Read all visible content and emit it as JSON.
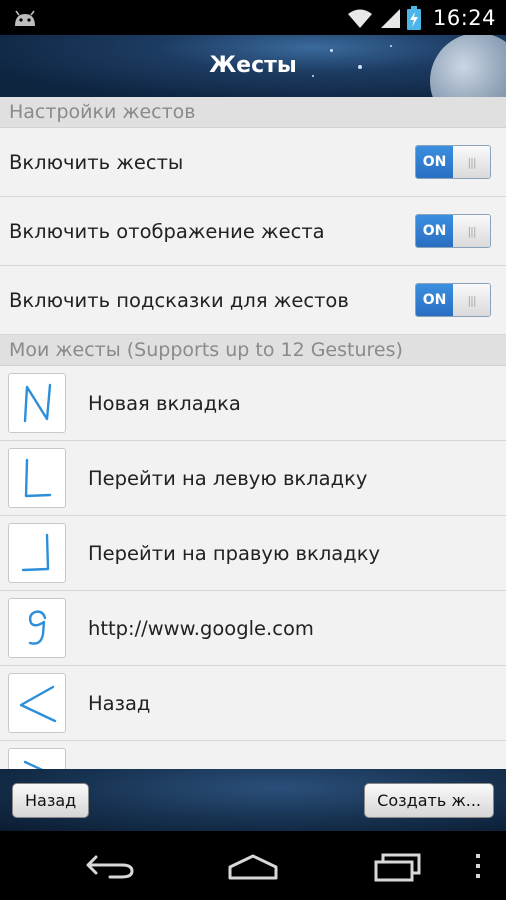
{
  "status_bar": {
    "time": "16:24",
    "icons": [
      "android-icon",
      "wifi-icon",
      "signal-icon",
      "battery-charging-icon"
    ]
  },
  "app_bar": {
    "title": "Жесты"
  },
  "settings_section": {
    "header": "Настройки жестов",
    "items": [
      {
        "label": "Включить жесты",
        "toggle": "ON"
      },
      {
        "label": "Включить отображение жеста",
        "toggle": "ON"
      },
      {
        "label": "Включить подсказки для жестов",
        "toggle": "ON"
      }
    ]
  },
  "gestures_section": {
    "header": "Мои жесты (Supports up to 12 Gestures)",
    "items": [
      {
        "label": "Новая вкладка",
        "glyph": "N"
      },
      {
        "label": "Перейти на левую вкладку",
        "glyph": "L"
      },
      {
        "label": "Перейти на правую вкладку",
        "glyph": "reverse-L"
      },
      {
        "label": "http://www.google.com",
        "glyph": "g"
      },
      {
        "label": "Назад",
        "glyph": "<"
      },
      {
        "label": "",
        "glyph": ">"
      }
    ]
  },
  "bottom_bar": {
    "back_label": "Назад",
    "create_label": "Создать ж..."
  },
  "colors": {
    "accent": "#2f7fd6",
    "gesture_stroke": "#2d8fd9",
    "title_bg": "#1d3c63"
  }
}
